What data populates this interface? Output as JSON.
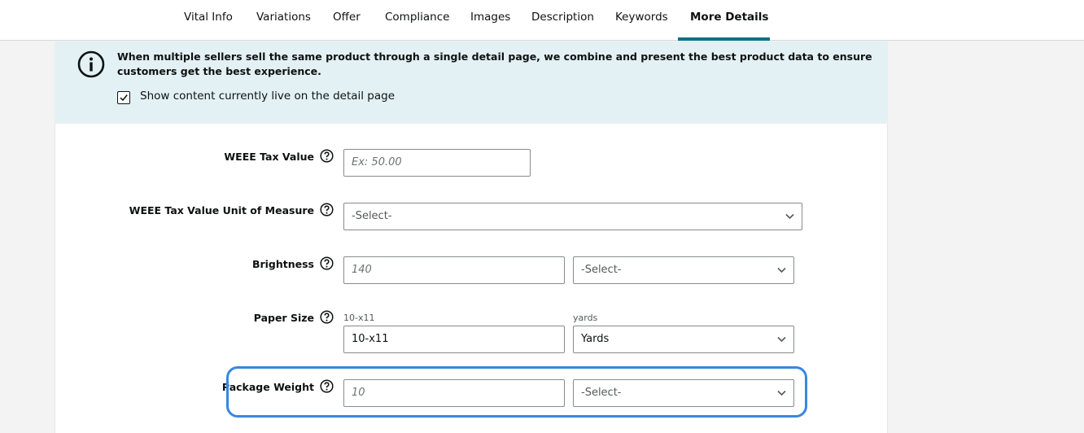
{
  "tabs": [
    {
      "label": "Vital Info"
    },
    {
      "label": "Variations"
    },
    {
      "label": "Offer"
    },
    {
      "label": "Compliance"
    },
    {
      "label": "Images"
    },
    {
      "label": "Description"
    },
    {
      "label": "Keywords"
    },
    {
      "label": "More Details"
    }
  ],
  "active_tab": "More Details",
  "banner": {
    "text": "When multiple sellers sell the same product through a single detail page, we combine and present the best product data to ensure customers get the best experience.",
    "checkbox_label": "Show content currently live on the detail page",
    "checkbox_checked": true
  },
  "fields": {
    "weee_tax_value": {
      "label": "WEEE Tax Value",
      "placeholder": "Ex: 50.00"
    },
    "weee_uom": {
      "label": "WEEE Tax Value Unit of Measure",
      "select": "-Select-"
    },
    "brightness": {
      "label": "Brightness",
      "placeholder": "140",
      "select": "-Select-"
    },
    "paper_size": {
      "label": "Paper Size",
      "value_caption": "10-x11",
      "value": "10-x11",
      "unit_caption": "yards",
      "unit": "Yards"
    },
    "package_weight": {
      "label": "Package Weight",
      "placeholder": "10",
      "select": "-Select-"
    }
  },
  "colors": {
    "accent": "#007185",
    "banner_bg": "#e3f1f4",
    "highlight": "#3a86e0"
  },
  "icons": {
    "info": "info-circle-icon",
    "help": "question-circle-icon",
    "chevron": "chevron-down-icon",
    "check": "checkmark-icon"
  }
}
